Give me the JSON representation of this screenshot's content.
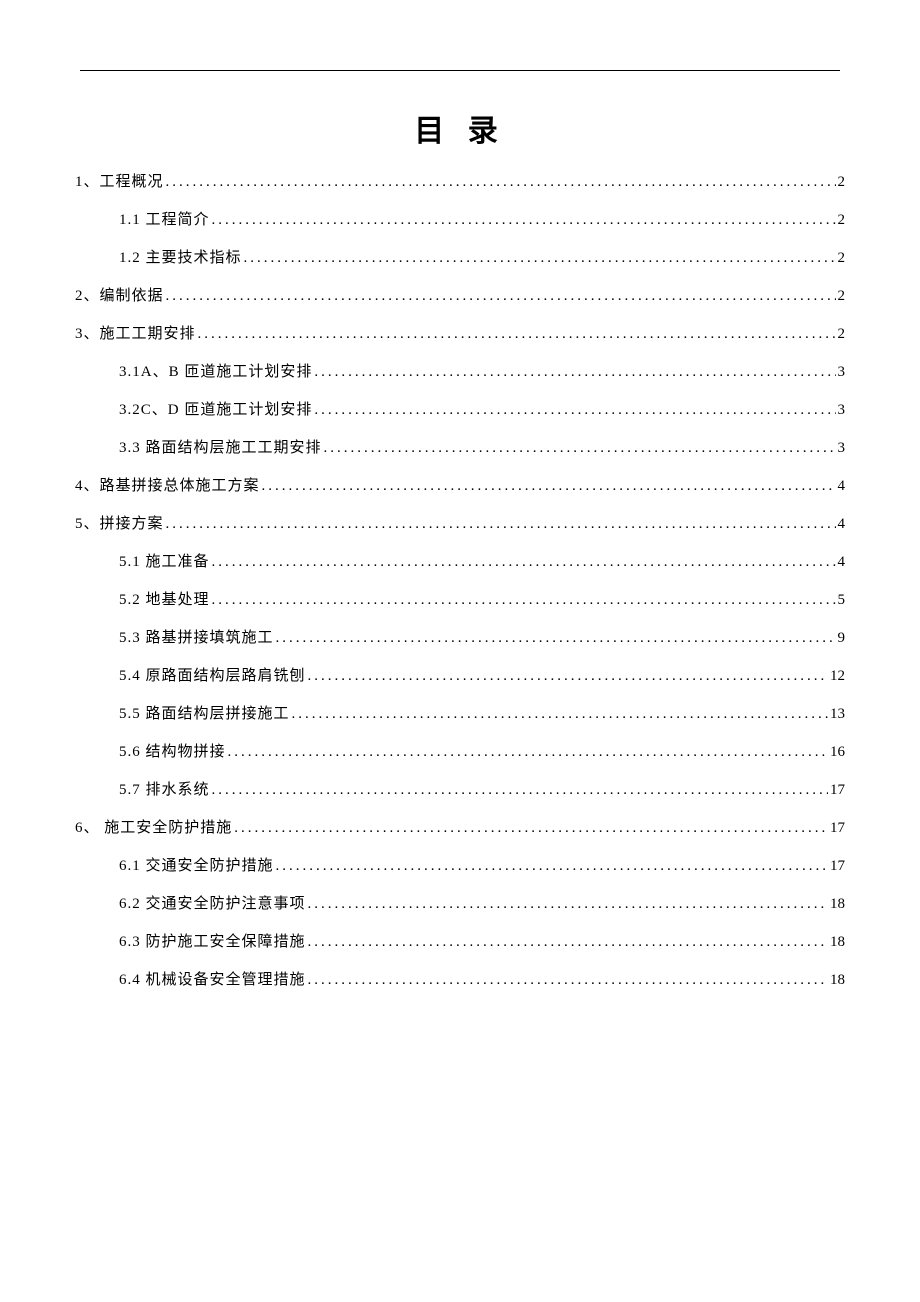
{
  "title": "目 录",
  "toc": [
    {
      "level": 1,
      "label": "1、工程概况",
      "page": "2"
    },
    {
      "level": 2,
      "label": "1.1 工程简介",
      "page": "2"
    },
    {
      "level": 2,
      "label": "1.2 主要技术指标",
      "page": "2"
    },
    {
      "level": 1,
      "label": "2、编制依据",
      "page": "2"
    },
    {
      "level": 1,
      "label": "3、施工工期安排",
      "page": "2"
    },
    {
      "level": 2,
      "label": "3.1A、B 匝道施工计划安排",
      "page": "3"
    },
    {
      "level": 2,
      "label": "3.2C、D 匝道施工计划安排",
      "page": "3"
    },
    {
      "level": 2,
      "label": "3.3 路面结构层施工工期安排",
      "page": "3"
    },
    {
      "level": 1,
      "label": "4、路基拼接总体施工方案",
      "page": "4"
    },
    {
      "level": 1,
      "label": "5、拼接方案",
      "page": "4"
    },
    {
      "level": 2,
      "label": "5.1 施工准备",
      "page": "4"
    },
    {
      "level": 2,
      "label": "5.2 地基处理",
      "page": "5"
    },
    {
      "level": 2,
      "label": "5.3 路基拼接填筑施工",
      "page": "9"
    },
    {
      "level": 2,
      "label": "5.4 原路面结构层路肩铣刨",
      "page": "12"
    },
    {
      "level": 2,
      "label": "5.5 路面结构层拼接施工",
      "page": "13"
    },
    {
      "level": 2,
      "label": "5.6 结构物拼接",
      "page": "16"
    },
    {
      "level": 2,
      "label": "5.7 排水系统",
      "page": "17"
    },
    {
      "level": 1,
      "label": "6、 施工安全防护措施",
      "page": "17"
    },
    {
      "level": 2,
      "label": "6.1 交通安全防护措施",
      "page": "17"
    },
    {
      "level": 2,
      "label": "6.2 交通安全防护注意事项 ",
      "page": "18"
    },
    {
      "level": 2,
      "label": "6.3 防护施工安全保障措施",
      "page": "18"
    },
    {
      "level": 2,
      "label": "6.4 机械设备安全管理措施",
      "page": "18"
    }
  ]
}
